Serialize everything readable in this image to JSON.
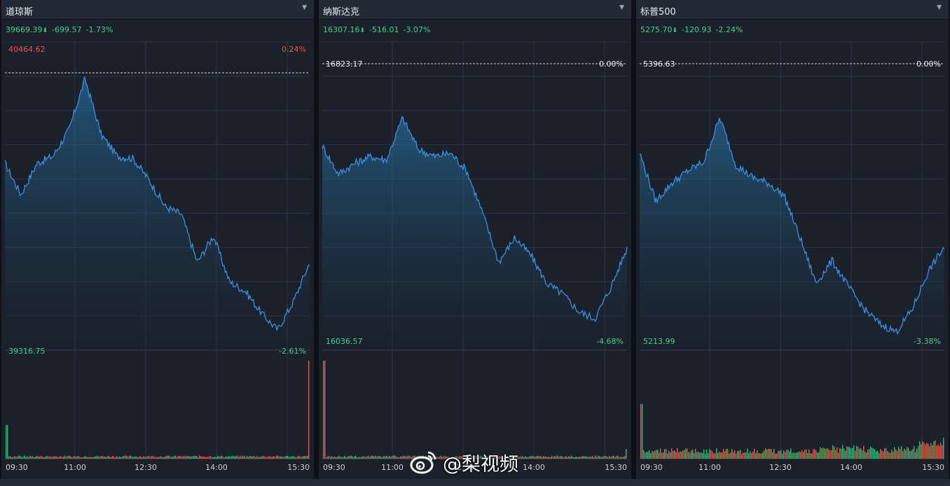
{
  "panels": [
    {
      "title": "道琼斯",
      "price": "39669.39",
      "change": "-699.57",
      "pct": "-1.73%",
      "ref_price": "40464.62",
      "ref_pct": "0.24%",
      "low_price": "39316.75",
      "low_pct": "-2.61%",
      "ref_color": "#e8564f",
      "ref_line_visible": true
    },
    {
      "title": "纳斯达克",
      "price": "16307.16",
      "change": "-516.01",
      "pct": "-3.07%",
      "ref_price": "16823.17",
      "ref_pct": "0.00%",
      "low_price": "16036.57",
      "low_pct": "-4.68%",
      "ref_color": "#e8edf2",
      "ref_line_visible": true
    },
    {
      "title": "标普500",
      "price": "5275.70",
      "change": "-120.93",
      "pct": "-2.24%",
      "ref_price": "5396.63",
      "ref_pct": "0.00%",
      "low_price": "5213.99",
      "low_pct": "-3.38%",
      "ref_color": "#e8edf2",
      "ref_line_visible": true
    }
  ],
  "time_labels": [
    "09:30",
    "11:00",
    "12:30",
    "14:00",
    "15:30"
  ],
  "watermark": "@梨视频",
  "colors": {
    "up": "#e8564f",
    "down": "#3fd08d",
    "line": "#3a8fe0",
    "bg": "#1a212b",
    "grid": "#2c3542"
  },
  "chart_data": [
    {
      "type": "line",
      "title": "道琼斯",
      "x": [
        "09:30",
        "11:00",
        "12:30",
        "14:00",
        "15:30"
      ],
      "series": [
        {
          "name": "道琼斯",
          "values": [
            40090,
            39960,
            40090,
            40120,
            40230,
            40440,
            40210,
            40120,
            40110,
            40020,
            39910,
            39880,
            39680,
            39790,
            39600,
            39560,
            39470,
            39400,
            39520,
            39680
          ]
        }
      ],
      "ylim": [
        39316.75,
        40464.62
      ]
    },
    {
      "type": "line",
      "title": "纳斯达克",
      "x": [
        "09:30",
        "11:00",
        "12:30",
        "14:00",
        "15:30"
      ],
      "series": [
        {
          "name": "纳斯达克",
          "values": [
            16590,
            16510,
            16540,
            16560,
            16550,
            16670,
            16580,
            16560,
            16570,
            16520,
            16400,
            16260,
            16330,
            16280,
            16200,
            16170,
            16120,
            16100,
            16190,
            16300
          ]
        }
      ],
      "ylim": [
        16036.57,
        16823.17
      ]
    },
    {
      "type": "line",
      "title": "标普500",
      "x": [
        "09:30",
        "11:00",
        "12:30",
        "14:00",
        "15:30"
      ],
      "series": [
        {
          "name": "标普500",
          "values": [
            5338,
            5306,
            5318,
            5326,
            5332,
            5361,
            5330,
            5322,
            5318,
            5310,
            5282,
            5252,
            5267,
            5250,
            5235,
            5225,
            5220,
            5235,
            5260,
            5276
          ]
        }
      ],
      "ylim": [
        5213.99,
        5396.63
      ]
    }
  ]
}
